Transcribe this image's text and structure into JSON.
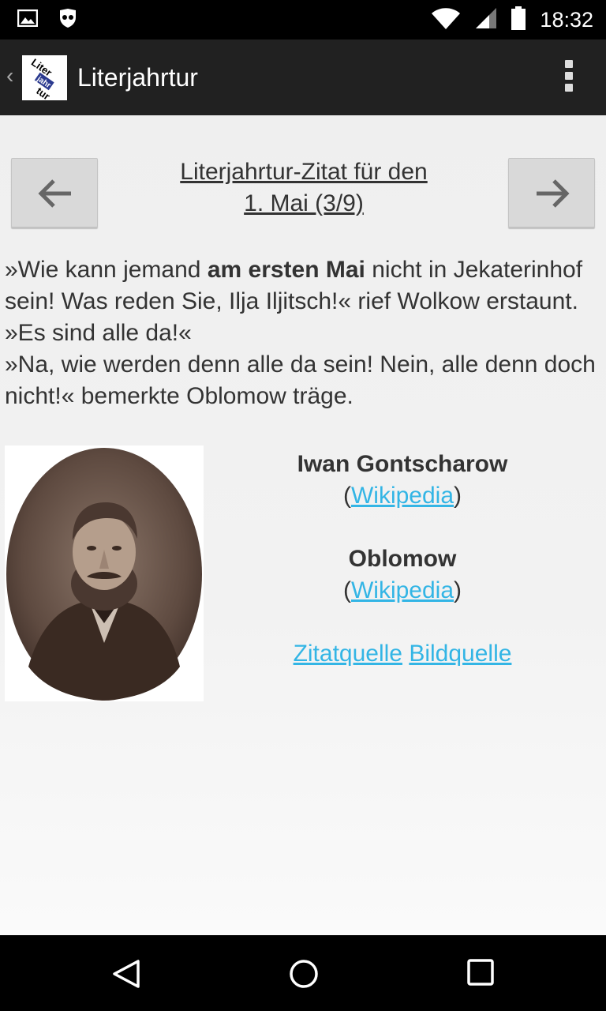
{
  "status_bar": {
    "time": "18:32",
    "icons": [
      "image-notification-icon",
      "incognito-icon",
      "wifi-icon",
      "signal-icon",
      "battery-icon"
    ]
  },
  "action_bar": {
    "title": "Literjahrtur",
    "logo_text": "Liter jahr tur"
  },
  "quote_nav": {
    "heading_line1": "Literjahrtur-Zitat für den",
    "heading_line2": "1. Mai (3/9)"
  },
  "quote": {
    "part1": "»Wie kann jemand ",
    "bold": "am ersten Mai",
    "part2": " nicht in Jekaterinhof sein! Was reden Sie, Ilja Iljitsch!« rief Wolkow erstaunt. »Es sind alle da!«",
    "part3": "»Na, wie werden denn alle da sein! Nein, alle denn doch nicht!« bemerkte Oblomow träge."
  },
  "author": {
    "name": "Iwan Gontscharow",
    "paren_open": "(",
    "wiki_label": "Wikipedia",
    "paren_close": ")"
  },
  "work": {
    "title": "Oblomow",
    "paren_open": "(",
    "wiki_label": "Wikipedia",
    "paren_close": ")"
  },
  "sources": {
    "quote_source": "Zitatquelle",
    "image_source": "Bildquelle"
  },
  "colors": {
    "link": "#33b5e5",
    "action_bar": "#212121",
    "text": "#333333"
  }
}
